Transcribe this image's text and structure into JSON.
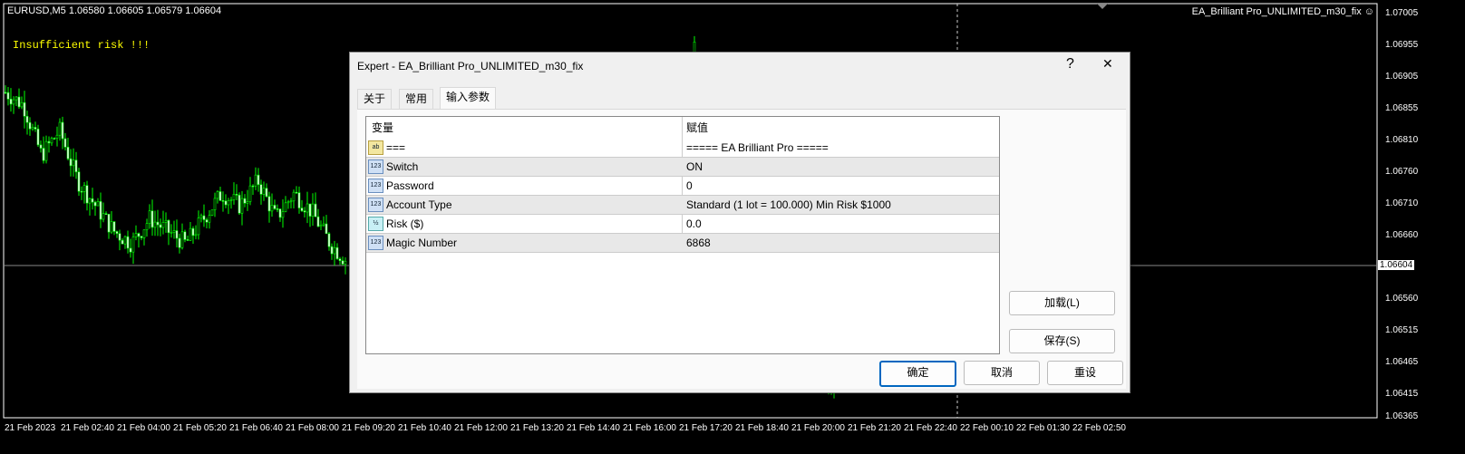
{
  "chart": {
    "symbol_line": "EURUSD,M5  1.06580 1.06605 1.06579 1.06604",
    "warning": "Insufficient risk !!!",
    "ea_name": "EA_Brilliant Pro_UNLIMITED_m30_fix",
    "current_price": "1.06604",
    "price_labels": [
      "1.07005",
      "1.06955",
      "1.06905",
      "1.06855",
      "1.06810",
      "1.06760",
      "1.06710",
      "1.06660",
      "1.06560",
      "1.06515",
      "1.06465",
      "1.06415",
      "1.06365"
    ],
    "time_labels": [
      "21 Feb 2023",
      "21 Feb 02:40",
      "21 Feb 04:00",
      "21 Feb 05:20",
      "21 Feb 06:40",
      "21 Feb 08:00",
      "21 Feb 09:20",
      "21 Feb 10:40",
      "21 Feb 12:00",
      "21 Feb 13:20",
      "21 Feb 14:40",
      "21 Feb 16:00",
      "21 Feb 17:20",
      "21 Feb 18:40",
      "21 Feb 20:00",
      "21 Feb 21:20",
      "21 Feb 22:40",
      "22 Feb 00:10",
      "22 Feb 01:30",
      "22 Feb 02:50"
    ],
    "price_path": [
      1.0688,
      1.0686,
      1.0678,
      1.0682,
      1.0674,
      1.067,
      1.0666,
      1.0664,
      1.0668,
      1.0666,
      1.0664,
      1.0668,
      1.0672,
      1.067,
      1.0674,
      1.0668,
      1.0672,
      1.0669,
      1.0664,
      1.0661
    ]
  },
  "dialog": {
    "title": "Expert - EA_Brilliant Pro_UNLIMITED_m30_fix",
    "help": "?",
    "close": "✕",
    "tabs": [
      "关于",
      "常用",
      "输入参数"
    ],
    "table": {
      "headers": [
        "变量",
        "赋值"
      ],
      "rows": [
        {
          "icon": "ab",
          "name": "===",
          "value": "===== EA Brilliant Pro ====="
        },
        {
          "icon": "123",
          "name": "Switch",
          "value": "ON"
        },
        {
          "icon": "123",
          "name": "Password",
          "value": "0"
        },
        {
          "icon": "123",
          "name": "Account Type",
          "value": "Standard (1 lot = 100.000) Min Risk $1000"
        },
        {
          "icon": "½",
          "name": "Risk ($)",
          "value": "0.0"
        },
        {
          "icon": "123",
          "name": "Magic Number",
          "value": "6868"
        }
      ]
    },
    "load": "加载(L)",
    "save": "保存(S)",
    "ok": "确定",
    "cancel": "取消",
    "reset": "重设"
  }
}
